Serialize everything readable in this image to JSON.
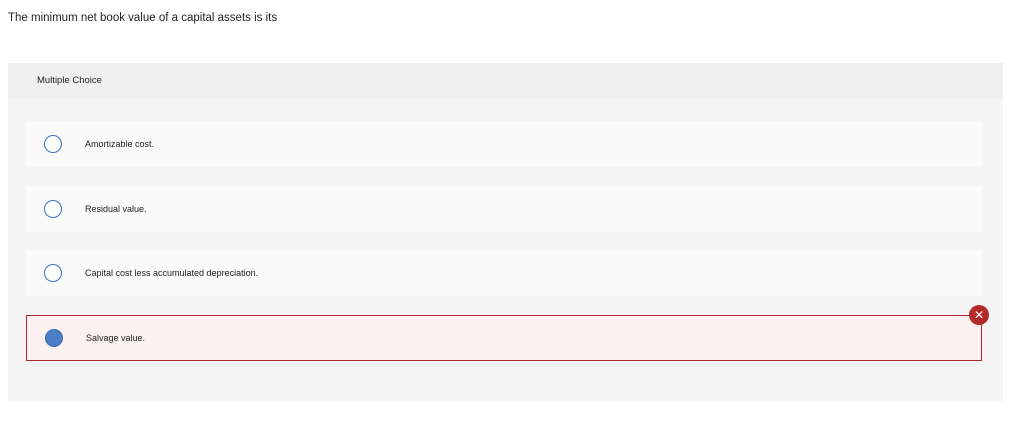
{
  "question": {
    "text": "The minimum net book value of a capital assets is its"
  },
  "panel": {
    "header": "Multiple Choice",
    "options": [
      {
        "label": "Amortizable cost.",
        "selected": false
      },
      {
        "label": "Residual value.",
        "selected": false
      },
      {
        "label": "Capital cost less accumulated depreciation.",
        "selected": false
      },
      {
        "label": "Salvage value.",
        "selected": true,
        "status": "incorrect"
      }
    ],
    "incorrect_icon": "x-icon",
    "colors": {
      "incorrect": "#b32a2a",
      "radio_accent": "#4a7ec6"
    }
  }
}
